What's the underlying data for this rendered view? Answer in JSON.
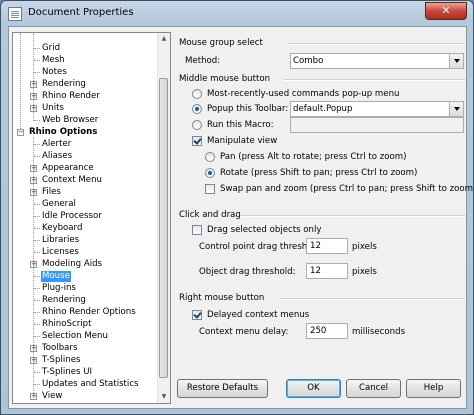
{
  "window": {
    "title": "Document Properties",
    "close_glyph": "✕"
  },
  "tree": {
    "items": [
      {
        "label": "Grid",
        "level": 1,
        "expander": false,
        "selected": false,
        "bold": false
      },
      {
        "label": "Mesh",
        "level": 1,
        "expander": false,
        "selected": false,
        "bold": false
      },
      {
        "label": "Notes",
        "level": 1,
        "expander": false,
        "selected": false,
        "bold": false
      },
      {
        "label": "Rendering",
        "level": 1,
        "expander": true,
        "selected": false,
        "bold": false
      },
      {
        "label": "Rhino Render",
        "level": 1,
        "expander": true,
        "selected": false,
        "bold": false
      },
      {
        "label": "Units",
        "level": 1,
        "expander": true,
        "selected": false,
        "bold": false
      },
      {
        "label": "Web Browser",
        "level": 1,
        "expander": false,
        "selected": false,
        "bold": false
      },
      {
        "label": "Rhino Options",
        "level": 0,
        "expander": true,
        "expanded": true,
        "selected": false,
        "bold": true
      },
      {
        "label": "Alerter",
        "level": 1,
        "expander": false,
        "selected": false,
        "bold": false
      },
      {
        "label": "Aliases",
        "level": 1,
        "expander": false,
        "selected": false,
        "bold": false
      },
      {
        "label": "Appearance",
        "level": 1,
        "expander": true,
        "selected": false,
        "bold": false
      },
      {
        "label": "Context Menu",
        "level": 1,
        "expander": true,
        "selected": false,
        "bold": false
      },
      {
        "label": "Files",
        "level": 1,
        "expander": true,
        "selected": false,
        "bold": false
      },
      {
        "label": "General",
        "level": 1,
        "expander": false,
        "selected": false,
        "bold": false
      },
      {
        "label": "Idle Processor",
        "level": 1,
        "expander": false,
        "selected": false,
        "bold": false
      },
      {
        "label": "Keyboard",
        "level": 1,
        "expander": false,
        "selected": false,
        "bold": false
      },
      {
        "label": "Libraries",
        "level": 1,
        "expander": false,
        "selected": false,
        "bold": false
      },
      {
        "label": "Licenses",
        "level": 1,
        "expander": false,
        "selected": false,
        "bold": false
      },
      {
        "label": "Modeling Aids",
        "level": 1,
        "expander": true,
        "selected": false,
        "bold": false
      },
      {
        "label": "Mouse",
        "level": 1,
        "expander": false,
        "selected": true,
        "bold": false
      },
      {
        "label": "Plug-ins",
        "level": 1,
        "expander": false,
        "selected": false,
        "bold": false
      },
      {
        "label": "Rendering",
        "level": 1,
        "expander": false,
        "selected": false,
        "bold": false
      },
      {
        "label": "Rhino Render Options",
        "level": 1,
        "expander": false,
        "selected": false,
        "bold": false
      },
      {
        "label": "RhinoScript",
        "level": 1,
        "expander": false,
        "selected": false,
        "bold": false
      },
      {
        "label": "Selection Menu",
        "level": 1,
        "expander": false,
        "selected": false,
        "bold": false
      },
      {
        "label": "Toolbars",
        "level": 1,
        "expander": true,
        "selected": false,
        "bold": false
      },
      {
        "label": "T-Splines",
        "level": 1,
        "expander": true,
        "selected": false,
        "bold": false
      },
      {
        "label": "T-Splines UI",
        "level": 1,
        "expander": false,
        "selected": false,
        "bold": false
      },
      {
        "label": "Updates and Statistics",
        "level": 1,
        "expander": false,
        "selected": false,
        "bold": false
      },
      {
        "label": "View",
        "level": 1,
        "expander": true,
        "selected": false,
        "bold": false
      }
    ]
  },
  "mouse_group": {
    "title": "Mouse group select",
    "method_label": "Method:",
    "method_value": "Combo"
  },
  "middle_button": {
    "title": "Middle mouse button",
    "opt_mru": "Most-recently-used commands pop-up menu",
    "opt_popup": "Popup this Toolbar:",
    "popup_value": "default.Popup",
    "opt_macro": "Run this Macro:",
    "macro_value": "",
    "manipulate": "Manipulate view",
    "pan": "Pan (press Alt to rotate; press Ctrl to zoom)",
    "rotate": "Rotate (press Shift to pan; press Ctrl to zoom)",
    "swap": "Swap pan and zoom (press Ctrl to pan; press Shift to zoom)",
    "selected_option": "popup",
    "manipulate_checked": true,
    "view_mode": "rotate",
    "swap_checked": false
  },
  "click_drag": {
    "title": "Click and drag",
    "drag_selected": "Drag selected objects only",
    "drag_selected_checked": false,
    "cp_label": "Control point drag threshold:",
    "cp_value": "12",
    "cp_unit": "pixels",
    "obj_label": "Object drag threshold:",
    "obj_value": "12",
    "obj_unit": "pixels"
  },
  "right_button": {
    "title": "Right mouse button",
    "delayed": "Delayed context menus",
    "delayed_checked": true,
    "delay_label": "Context menu delay:",
    "delay_value": "250",
    "delay_unit": "milliseconds"
  },
  "buttons": {
    "restore": "Restore Defaults",
    "ok": "OK",
    "cancel": "Cancel",
    "help": "Help"
  },
  "icons": {
    "app": "document-icon",
    "close": "close-icon",
    "scroll_up": "chevron-up-icon",
    "scroll_down": "chevron-down-icon"
  }
}
